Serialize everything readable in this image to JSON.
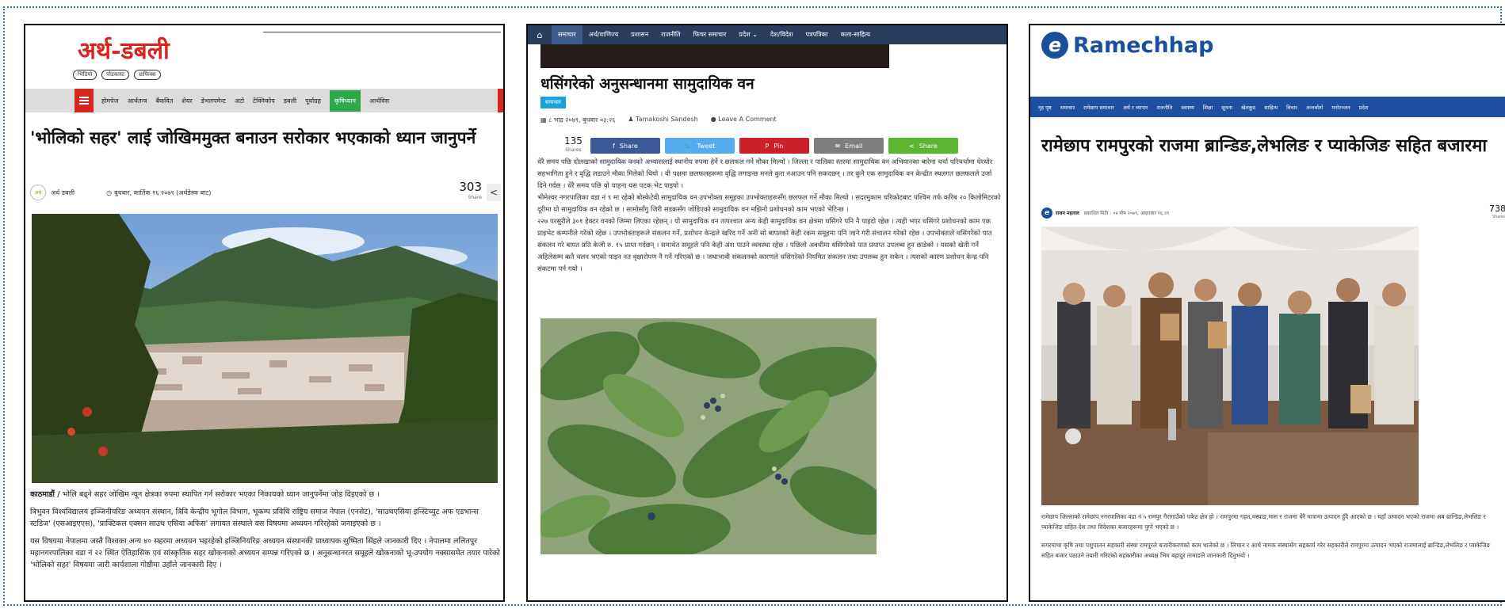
{
  "panel1": {
    "logo": "अर्थ-डबली",
    "pills": [
      "भिडियो",
      "पोडकास्ट",
      "ग्राफिक्स"
    ],
    "nav_items": [
      "होमपेज",
      "आर्थतन्त्र",
      "बैंकवित",
      "शेयर",
      "डेभलपमेन्ट",
      "अटो",
      "टेक्निकोप",
      "डबली",
      "पूर्वाग्रह",
      "कृषिध्यान",
      "आर्थविस"
    ],
    "nav_active_index": 9,
    "title": "'भोलिको सहर' लाई जोखिममुक्त बनाउन सरोकार भएकाको ध्यान जानुपर्ने",
    "author": "अर्थ डबली",
    "date": "बुधबार, कार्तिक १६ २०७९ (अर्थडेस्क बाट)",
    "shares": "303",
    "shares_label": "Share",
    "para1_lead": "काठमाडौं /",
    "para1": " भोलि बढ्ने सहर जोखिम न्यून क्षेत्रका रुपमा स्थापित गर्न सरोकार भएका निकायको ध्यान जानुपर्नेमा जोड दिइएको छ ।",
    "para2": "त्रिभुवन विश्वविद्यालय इञ्जिनीयरिङ अध्ययन संस्थान, त्रिवि केन्द्रीय भूगोल विभाग, भूकम्प प्रविधि राष्ट्रिय समाज नेपाल (एनसेट), 'साउथएसिया इन्स्टिच्युट अफ एडभान्स स्टडिज' (एसआइएएस), 'प्राक्टिकल एक्सन साउथ एसिया अफिस' लगायत संस्थाले यस विषयमा अध्ययन गरिरहेको जनाइएको छ ।",
    "para3": "यस विषयमा नेपालमा जस्तै विश्वका अन्य ४० सहरमा अध्ययन भइरहेको इञ्जिनियरिङ अध्ययन संस्थानकी प्राध्यापक सुष्मिता सिंहले जानकारी दिए । नेपालमा ललितपुर महानगरपालिका वडा नं २२ स्थित ऐतिहासिक एवं सांस्कृतिक सहर खोकनाको अध्ययन सम्पन्न गरिएको छ । अनुसन्धानरत समूहले खोकनाको भू-उपयोग नक्सासमेत तयार पारेको 'भोलिको सहर' विषयमा जारी कार्यशाला गोष्ठीमा उहाँले जानकारी दिए ।"
  },
  "panel2": {
    "nav_items": [
      "समाचार",
      "अर्थ/वाणिज्य",
      "प्रशासन",
      "राजनीति",
      "फिचर समाचार",
      "प्रदेश ⌄",
      "देश/विदेश",
      "पत्रपत्रिका",
      "कला-साहित्य"
    ],
    "nav_active_index": 0,
    "title": "धसिंगरेको अनुसन्धानमा सामुदायिक वन",
    "category": "समाचार",
    "date": "८ भाद्र २०७९, बुधबार ०३:२६",
    "author": "Tamakoshi Sandesh",
    "comment": "Leave A Comment",
    "share_count": "135",
    "share_count_label": "Shares",
    "share_buttons": [
      {
        "label": "Share",
        "icon": "f",
        "color": "#3b5998"
      },
      {
        "label": "Tweet",
        "icon": "🐦",
        "color": "#55acee"
      },
      {
        "label": "Pin",
        "icon": "P",
        "color": "#cb2027"
      },
      {
        "label": "Email",
        "icon": "✉",
        "color": "#7d7d7d"
      },
      {
        "label": "Share",
        "icon": "<",
        "color": "#5cb531"
      }
    ],
    "paragraphs": [
      "धेरै समय पछि दोलखाको सामुदायिक वनको अभ्यासलाई स्थानीय रुपमा हेर्ने र छलफल गर्ने मौका मिल्यो । जिल्ला र पालिका स्तरमा सामुदायिक वन अभियानका बारेमा चर्चा परिचर्चामा धेरथोर सहभागिता हुने र वृद्धि लडाउने मौका मिलेको थियो । यी पक्षमा छलफलहरूमा वृद्धि लगाइन्छ मनले कुरा नआउन पनि सकदछन् । तर कुनै एक सामुदायिक वन केन्द्रीत स्थलगत छलफलले उर्जा दिने गर्दछ । धेरै समय पछि यो चाहना यस पटक भेट पाइयो ।",
      "भीमेश्वर नगरपालिका वडा नं ९ मा रहेको बोस्केटेवी सामुदायिक वन उपभोक्ता समूहका उपभोक्ताहरूसँग छलफल गर्ने मौका मिल्यो । सदरमुकाम चरिकोटबाट पश्चिम तर्फ करिब २० किलोमिटरको दूरीमा यो सामुदायिक वन रहेको छ । सामोसाँगु जिरी सडकसँग जोडिएको सामुदायिक वन मझिनो प्रशोधनको काम भएको भेटिन्छ ।",
      "२२७ परसुरीले ३०१ हेक्टर वनको जिम्मा लिएका रहेछन् । यो सामुदायिक वन तत्पश्चात अन्य केही सामुदायिक वन क्षेत्रमा धसिंगरे पनि नै पाइदो रहेछ । त्यही भएर धसिंगरे प्रशोधनको काम एक प्राइभेट कम्पनीले गरेको रहेछ । उपभोक्ताहरूले संकलन गर्ने, प्रशोधन केन्द्रले खरिद गर्ने अनी सो बापतको केही रकम समूहमा पनि जाने गरी संचालन गरेको रहेछ । उपभोक्ताले धसिंगरेको पात संकलन गरे बापत प्रति केजी रु. १५ प्राप्त गर्दछन् । समाथेत समूहले पनि केही अंश पाउने व्यवस्था रहेछ । पछिलो अवधीमा धसिंगरेको पात प्रयाप्त उपलब्ध हुन छाडेको । यसको खेती गर्ने अहिलेसम्म कतै चलन भएको पाइन नत वृक्षारोपण नै गर्ने गरिएको छ । जथाभावी संकलनको कारणले धसिंगरेको नियमित संकलन तथा उपलब्ध हुन सकेन । त्यसको कारण प्रशोधन केन्द्र पनि संकटमा पर्न गयो ।"
    ]
  },
  "panel3": {
    "logo_letter": "e",
    "logo_text": "Ramechhap",
    "nav_items": [
      "गृह पृष्ठ",
      "समाचार",
      "रामेछाप समाचार",
      "अर्थ र व्यापार",
      "राजनीति",
      "स्वास्थ्य",
      "शिक्षा",
      "सूचना",
      "खेलकुद",
      "साहित्य",
      "विचार",
      "अन्तर्वार्ता",
      "मनोरञ्जन",
      "प्रदेश"
    ],
    "title": "रामेछाप रामपुरको राजमा ब्रान्डिङ,लेभलिङ र प्याकेजिङ सहित बजारमा",
    "author": "राजन महताल",
    "date": "प्रकाशित मिति : ०४ पौष २०७९, आइतबार १६:२१",
    "shares": "738",
    "shares_label": "Shares",
    "para1": "रामेछाप जिल्लाको रामेछाप नगरपालिका वडा नं ५ रामपुर गैरागाउँको पकेट क्षेत्र हो । रामपुरमा गहत,मस्याङ,मास र राजमा धेरै मात्रामा उत्पादन हुँदै आएको छ । यहाँ उत्पादन भएको राजमा अब ब्रान्डिङ,लेभलिङ र प्याकेजिङ सहित देश तथा विदेशका बजारहरूमा पुग्ने भएको छ ।",
    "para2": "सगरमाथा कृषि तथा पशुपालन सहकारी संस्था रामपुरले बजारीकरणको काम थालेको छ । लिचान र आर्थ नामक संस्थासँग सहकार्य गरेर सहकारीले रामपुरमा उत्पादन भएको राजमालाई ब्रान्डिङ,लेभलिङ र प्याकेजिङ सहित बजार पठाउने तयारी गरिएको सहकारीका अध्यक्ष भिम बहादुर तामाङले जानकारी दिनुभयो ।"
  }
}
